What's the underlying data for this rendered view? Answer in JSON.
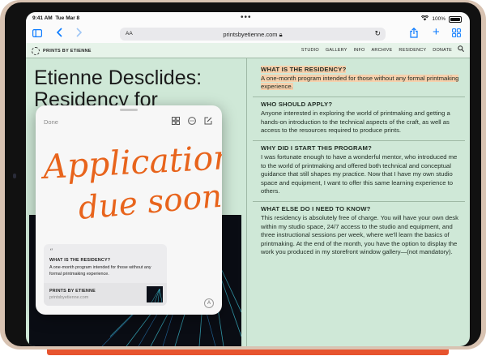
{
  "status": {
    "time": "9:41 AM",
    "date": "Tue Mar 8",
    "battery_text": "100%",
    "battery_level": 1.0
  },
  "toolbar": {
    "url_prefix": "AA",
    "url": "printsbyetienne.com",
    "icons": [
      "sidebar-icon",
      "back-icon",
      "forward-icon",
      "reload-icon",
      "share-icon",
      "plus-icon",
      "tabs-grid-icon"
    ]
  },
  "site": {
    "brand": "PRINTS BY ETIENNE",
    "nav": [
      "STUDIO",
      "GALLERY",
      "INFO",
      "ARCHIVE",
      "RESIDENCY",
      "DONATE"
    ],
    "title_line1": "Etienne Desclides:",
    "title_line2": "Residency for"
  },
  "faq": [
    {
      "q": "WHAT IS THE RESIDENCY?",
      "a": "A one-month program intended for those without any formal printmaking experience."
    },
    {
      "q": "WHO SHOULD APPLY?",
      "a": "Anyone interested in exploring the world of printmaking and getting a hands-on introduction to the technical aspects of the craft, as well as access to the resources required to produce prints."
    },
    {
      "q": "WHY DID I START THIS PROGRAM?",
      "a": "I was fortunate enough to have a wonderful mentor, who introduced me to the world of printmaking and offered both technical and conceptual guidance that still shapes my practice. Now that I have my own studio space and equipment, I want to offer this same learning experience to others."
    },
    {
      "q": "WHAT ELSE DO I NEED TO KNOW?",
      "a": "This residency is absolutely free of charge. You will have your own desk within my studio space, 24/7 access to the studio and equipment, and three instructional sessions per week, where we'll learn the basics of printmaking. At the end of the month, you have the option to display the work you produced in my storefront window gallery—(not mandatory)."
    }
  ],
  "note": {
    "done_label": "Done",
    "handwriting_line1": "Application",
    "handwriting_line2": "due soon!",
    "ink_color": "#e8641c",
    "link_q": "WHAT IS THE RESIDENCY?",
    "link_a": "A one-month program intended for those without any formal printmaking experience.",
    "link_site": "PRINTS BY ETIENNE",
    "link_domain": "printsbyetienne.com"
  },
  "colors": {
    "accent": "#0a7aff",
    "page_bg": "#cfe8d7",
    "highlight": "#f6d0ac",
    "pencil": "#e7542f"
  }
}
